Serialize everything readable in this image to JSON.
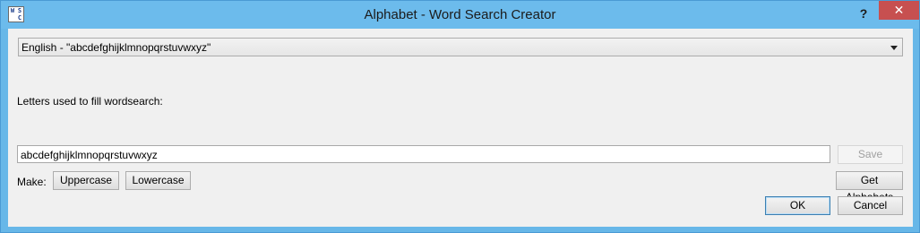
{
  "window": {
    "title": "Alphabet - Word Search Creator",
    "icon_letters": [
      "W",
      "S",
      "",
      "C"
    ],
    "help_label": "?",
    "close_label": "✕"
  },
  "alphabet_select": {
    "selected": "English - \"abcdefghijklmnopqrstuvwxyz\""
  },
  "fill": {
    "label": "Letters used to fill wordsearch:",
    "value": "abcdefghijklmnopqrstuvwxyz",
    "save_label": "Save"
  },
  "make": {
    "label": "Make:",
    "uppercase_label": "Uppercase",
    "lowercase_label": "Lowercase"
  },
  "get_alphabets_label": "Get Alphabets",
  "dialog": {
    "ok_label": "OK",
    "cancel_label": "Cancel"
  },
  "colors": {
    "titlebar": "#6cbbec",
    "close_button": "#c75050",
    "client_background": "#f0f0f0"
  }
}
